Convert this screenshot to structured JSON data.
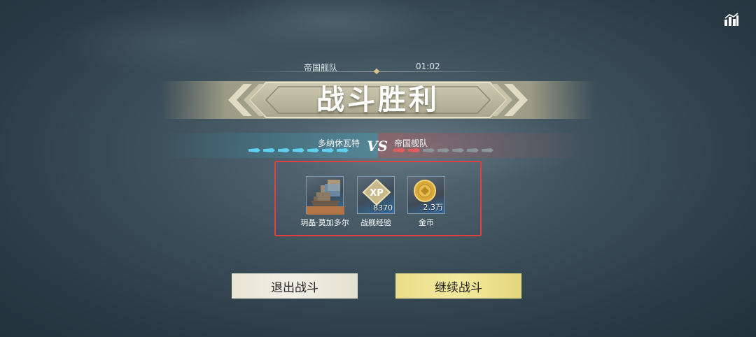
{
  "header": {
    "team_label": "帝国舰队",
    "timer": "01:02",
    "result_title": "战斗胜利"
  },
  "icons": {
    "stats": "bar-chart-icon"
  },
  "versus": {
    "left_team": "多纳休瓦特",
    "vs": "VS",
    "right_team": "帝国舰队",
    "left_color": "#5fd0ef",
    "right_color": "#e25a5a",
    "left_ships_alive": 7,
    "left_ships_total": 7,
    "right_ships_alive": 2,
    "right_ships_total": 7
  },
  "rewards": [
    {
      "icon": "battleship-icon",
      "count": "",
      "label": "玥晶·莫加多尔"
    },
    {
      "icon": "xp-icon",
      "count": "8370",
      "label": "战舰经验"
    },
    {
      "icon": "gold-coin-icon",
      "count": "2.3万",
      "label": "金币"
    }
  ],
  "buttons": {
    "exit": "退出战斗",
    "continue": "继续战斗"
  }
}
